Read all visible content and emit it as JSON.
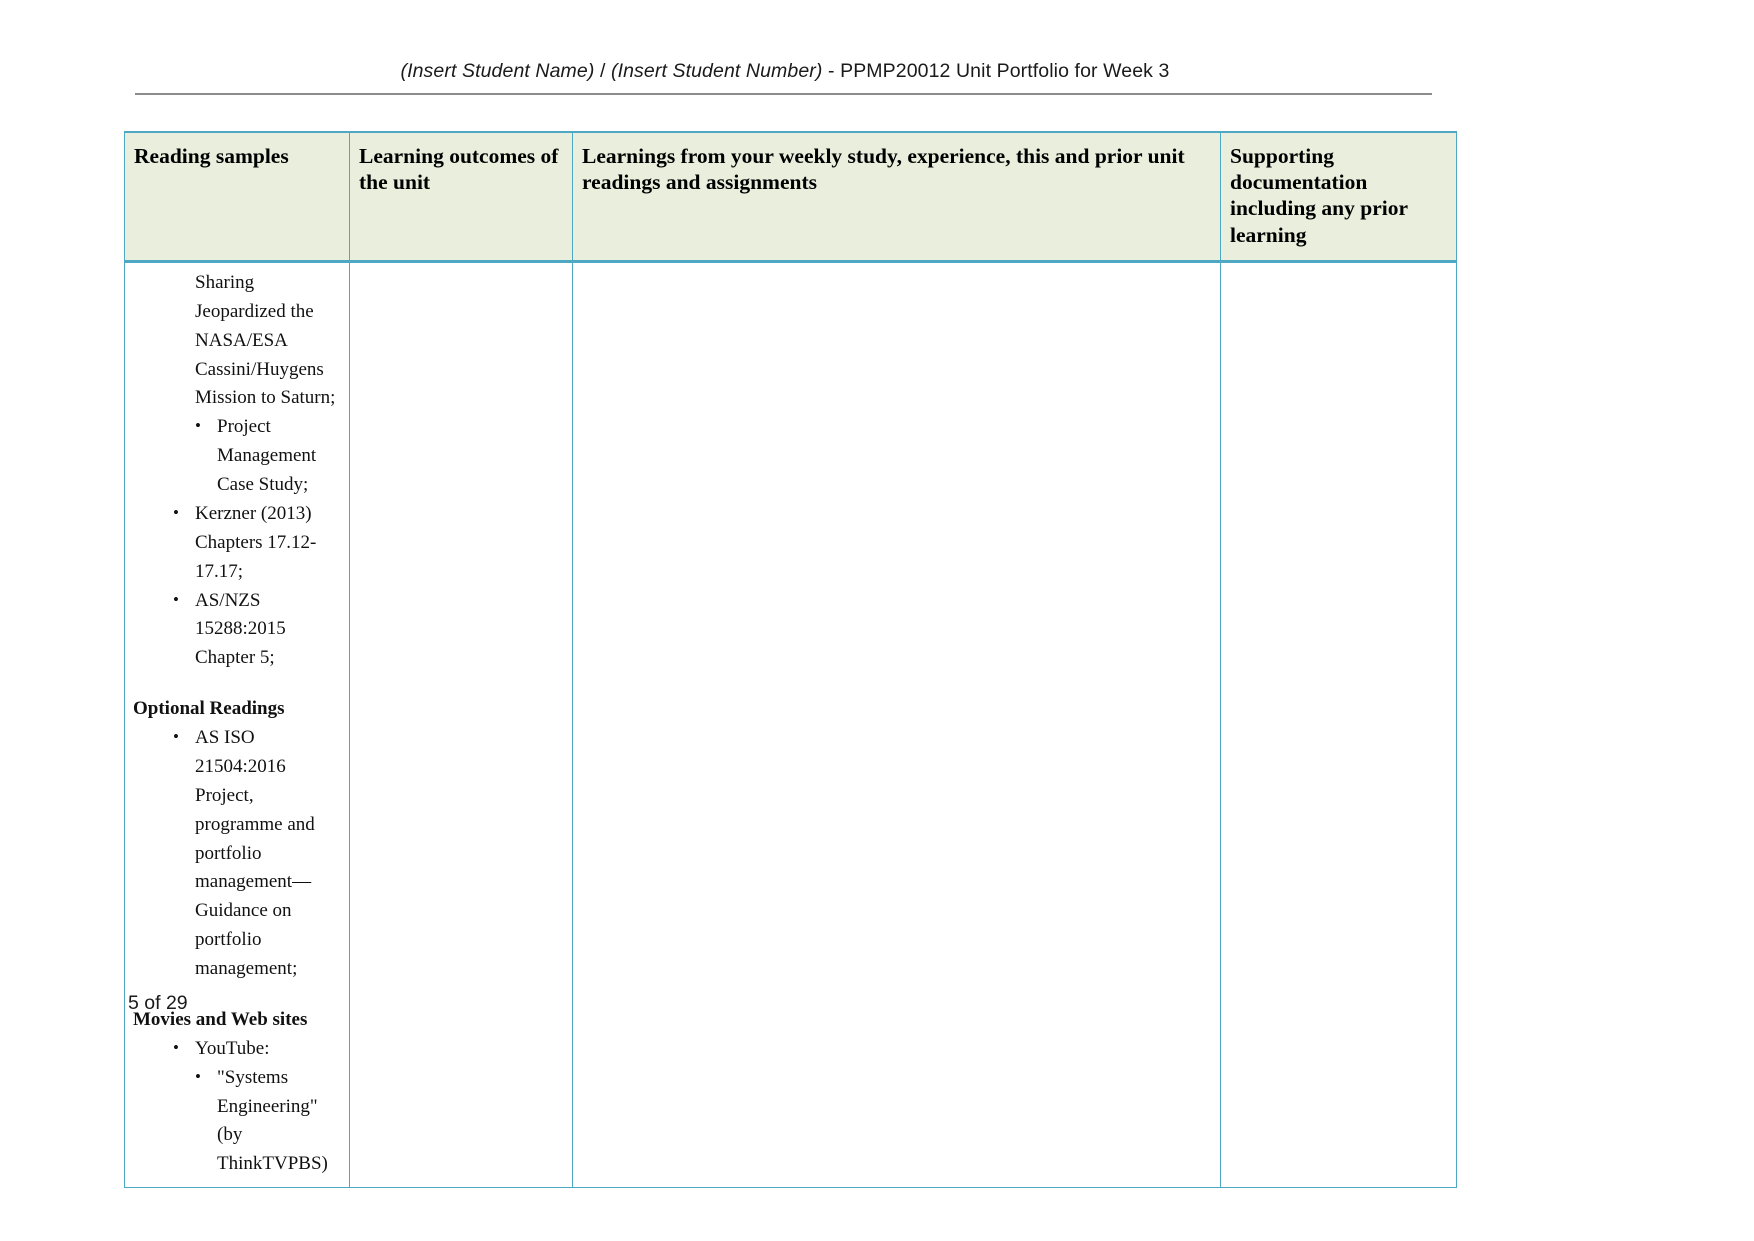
{
  "header": {
    "student_name_placeholder": "(Insert Student Name)",
    "separator": " / ",
    "student_number_placeholder": "(Insert Student Number)",
    "suffix": " - PPMP20012 Unit Portfolio for Week 3"
  },
  "table": {
    "columns": [
      {
        "label": "Reading samples"
      },
      {
        "label": "Learning outcomes of the unit"
      },
      {
        "label": "Learnings from your weekly study, experience, this and prior unit readings and assignments"
      },
      {
        "label": "Supporting documentation including any prior learning"
      }
    ],
    "row": {
      "reading_samples": {
        "continued_text": "Sharing Jeopardized the NASA/ESA Cassini/Huygens Mission to Saturn;",
        "items": [
          {
            "level": 2,
            "text": "Project Management Case Study;"
          },
          {
            "level": 1,
            "text": "Kerzner (2013) Chapters 17.12-17.17;"
          },
          {
            "level": 1,
            "text": "AS/NZS 15288:2015 Chapter 5;"
          }
        ],
        "optional_readings_heading": "Optional Readings",
        "optional_items": [
          {
            "level": 1,
            "text": "AS ISO 21504:2016 Project, programme and portfolio management—Guidance on portfolio management;"
          }
        ],
        "movies_heading": "Movies and Web sites",
        "movies_items": [
          {
            "level": 1,
            "text": "YouTube:"
          },
          {
            "level": 2,
            "text": "\"Systems Engineering\" (by ThinkTVPBS)"
          }
        ]
      },
      "learning_outcomes": "",
      "learnings": "",
      "supporting_documentation": ""
    }
  },
  "footer": {
    "page_indicator": "5 of 29"
  },
  "colors": {
    "table_border": "#4ea8c4",
    "header_fill": "#eaeedd",
    "rule": "#8b8b8b",
    "text": "#111111"
  }
}
